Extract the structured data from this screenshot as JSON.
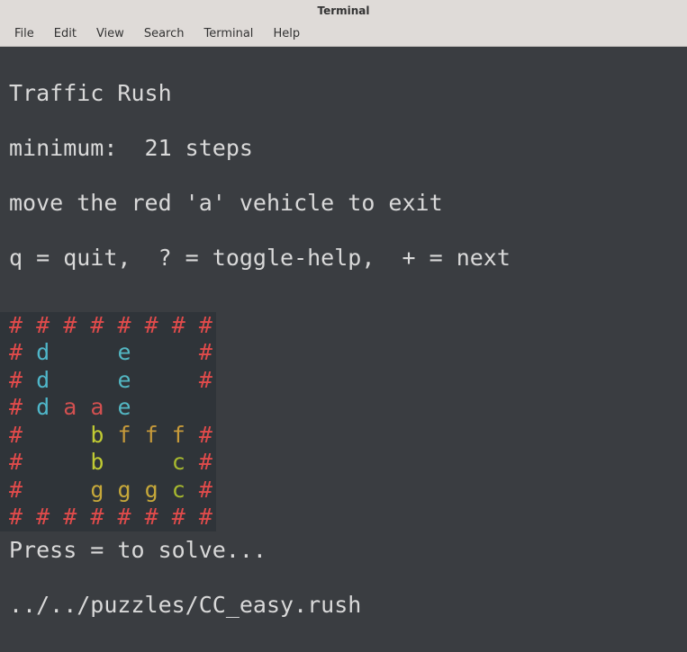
{
  "window": {
    "title": "Terminal"
  },
  "menu": {
    "file": "File",
    "edit": "Edit",
    "view": "View",
    "search": "Search",
    "terminal": "Terminal",
    "help": "Help"
  },
  "header": {
    "title": "Traffic Rush",
    "minimum_line": "minimum:  21 steps",
    "goal_line": "move the red 'a' vehicle to exit",
    "keys_line": "q = quit,  ? = toggle-help,  + = next"
  },
  "board": {
    "rows": [
      [
        [
          "#",
          "wall"
        ],
        [
          " ",
          "sp"
        ],
        [
          "#",
          "wall"
        ],
        [
          " ",
          "sp"
        ],
        [
          "#",
          "wall"
        ],
        [
          " ",
          "sp"
        ],
        [
          "#",
          "wall"
        ],
        [
          " ",
          "sp"
        ],
        [
          "#",
          "wall"
        ],
        [
          " ",
          "sp"
        ],
        [
          "#",
          "wall"
        ],
        [
          " ",
          "sp"
        ],
        [
          "#",
          "wall"
        ],
        [
          " ",
          "sp"
        ],
        [
          "#",
          "wall"
        ]
      ],
      [
        [
          "#",
          "wall"
        ],
        [
          " ",
          "sp"
        ],
        [
          "d",
          "d"
        ],
        [
          " ",
          "sp"
        ],
        [
          " ",
          "sp"
        ],
        [
          " ",
          "sp"
        ],
        [
          " ",
          "sp"
        ],
        [
          " ",
          "sp"
        ],
        [
          "e",
          "e"
        ],
        [
          " ",
          "sp"
        ],
        [
          " ",
          "sp"
        ],
        [
          " ",
          "sp"
        ],
        [
          " ",
          "sp"
        ],
        [
          " ",
          "sp"
        ],
        [
          "#",
          "wall"
        ]
      ],
      [
        [
          "#",
          "wall"
        ],
        [
          " ",
          "sp"
        ],
        [
          "d",
          "d"
        ],
        [
          " ",
          "sp"
        ],
        [
          " ",
          "sp"
        ],
        [
          " ",
          "sp"
        ],
        [
          " ",
          "sp"
        ],
        [
          " ",
          "sp"
        ],
        [
          "e",
          "e"
        ],
        [
          " ",
          "sp"
        ],
        [
          " ",
          "sp"
        ],
        [
          " ",
          "sp"
        ],
        [
          " ",
          "sp"
        ],
        [
          " ",
          "sp"
        ],
        [
          "#",
          "wall"
        ]
      ],
      [
        [
          "#",
          "wall"
        ],
        [
          " ",
          "sp"
        ],
        [
          "d",
          "d"
        ],
        [
          " ",
          "sp"
        ],
        [
          "a",
          "a"
        ],
        [
          " ",
          "sp"
        ],
        [
          "a",
          "a"
        ],
        [
          " ",
          "sp"
        ],
        [
          "e",
          "e"
        ],
        [
          " ",
          "sp"
        ],
        [
          " ",
          "sp"
        ],
        [
          " ",
          "sp"
        ],
        [
          " ",
          "sp"
        ],
        [
          " ",
          "sp"
        ],
        [
          " ",
          "sp"
        ]
      ],
      [
        [
          "#",
          "wall"
        ],
        [
          " ",
          "sp"
        ],
        [
          " ",
          "sp"
        ],
        [
          " ",
          "sp"
        ],
        [
          " ",
          "sp"
        ],
        [
          " ",
          "sp"
        ],
        [
          "b",
          "b"
        ],
        [
          " ",
          "sp"
        ],
        [
          "f",
          "f"
        ],
        [
          " ",
          "sp"
        ],
        [
          "f",
          "f"
        ],
        [
          " ",
          "sp"
        ],
        [
          "f",
          "f"
        ],
        [
          " ",
          "sp"
        ],
        [
          "#",
          "wall"
        ]
      ],
      [
        [
          "#",
          "wall"
        ],
        [
          " ",
          "sp"
        ],
        [
          " ",
          "sp"
        ],
        [
          " ",
          "sp"
        ],
        [
          " ",
          "sp"
        ],
        [
          " ",
          "sp"
        ],
        [
          "b",
          "b"
        ],
        [
          " ",
          "sp"
        ],
        [
          " ",
          "sp"
        ],
        [
          " ",
          "sp"
        ],
        [
          " ",
          "sp"
        ],
        [
          " ",
          "sp"
        ],
        [
          "c",
          "c"
        ],
        [
          " ",
          "sp"
        ],
        [
          "#",
          "wall"
        ]
      ],
      [
        [
          "#",
          "wall"
        ],
        [
          " ",
          "sp"
        ],
        [
          " ",
          "sp"
        ],
        [
          " ",
          "sp"
        ],
        [
          " ",
          "sp"
        ],
        [
          " ",
          "sp"
        ],
        [
          "g",
          "g"
        ],
        [
          " ",
          "sp"
        ],
        [
          "g",
          "g"
        ],
        [
          " ",
          "sp"
        ],
        [
          "g",
          "g"
        ],
        [
          " ",
          "sp"
        ],
        [
          "c",
          "c"
        ],
        [
          " ",
          "sp"
        ],
        [
          "#",
          "wall"
        ]
      ],
      [
        [
          "#",
          "wall"
        ],
        [
          " ",
          "sp"
        ],
        [
          "#",
          "wall"
        ],
        [
          " ",
          "sp"
        ],
        [
          "#",
          "wall"
        ],
        [
          " ",
          "sp"
        ],
        [
          "#",
          "wall"
        ],
        [
          " ",
          "sp"
        ],
        [
          "#",
          "wall"
        ],
        [
          " ",
          "sp"
        ],
        [
          "#",
          "wall"
        ],
        [
          " ",
          "sp"
        ],
        [
          "#",
          "wall"
        ],
        [
          " ",
          "sp"
        ],
        [
          "#",
          "wall"
        ]
      ]
    ]
  },
  "footer": {
    "solve_line": "Press = to solve...",
    "path_line": "../../puzzles/CC_easy.rush"
  }
}
